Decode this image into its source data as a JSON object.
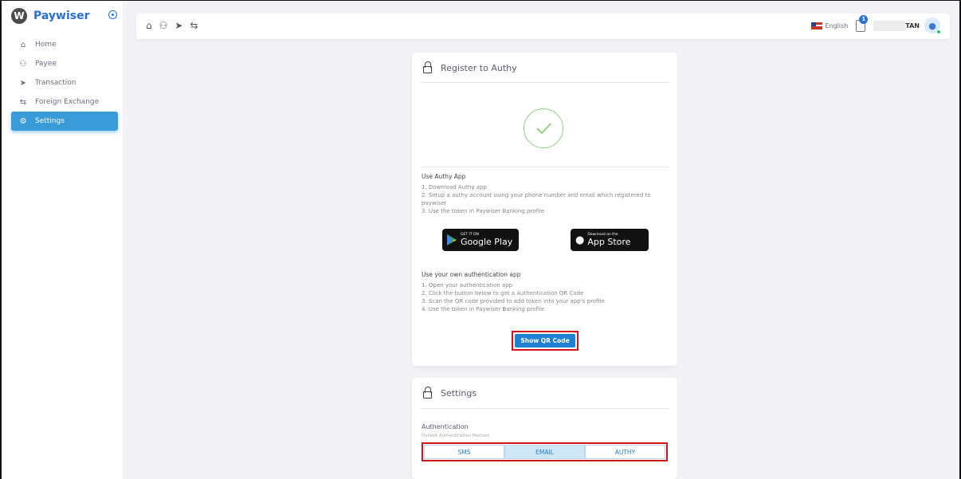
{
  "brand": {
    "name": "Paywiser",
    "logo_letter": "W"
  },
  "sidebar": {
    "items": [
      {
        "label": "Home",
        "icon": "home-icon",
        "glyph": "⌂",
        "active": false
      },
      {
        "label": "Payee",
        "icon": "users-icon",
        "glyph": "⚇",
        "active": false
      },
      {
        "label": "Transaction",
        "icon": "send-icon",
        "glyph": "➤",
        "active": false
      },
      {
        "label": "Foreign Exchange",
        "icon": "exchange-icon",
        "glyph": "⇆",
        "active": false
      },
      {
        "label": "Settings",
        "icon": "gear-icon",
        "glyph": "⚙",
        "active": true
      }
    ]
  },
  "topbar": {
    "language": "English",
    "notification_count": "1",
    "username": "TAN"
  },
  "authy_card": {
    "title": "Register to Authy",
    "authy_section_title": "Use Authy App",
    "authy_steps": [
      "1. Download Authy app",
      "2. Setup a authy account using your phone number and email which registered to paywiser",
      "3. Use the token in Paywiser Banking profile"
    ],
    "google_play": {
      "small": "GET IT ON",
      "large": "Google Play"
    },
    "app_store": {
      "small": "Download on the",
      "large": "App Store"
    },
    "own_app_title": "Use your own authentication app",
    "own_app_steps": [
      "1. Open your authentication app",
      "2. Click the button below to get a Authentication QR Code",
      "3. Scan the QR code provided to add token into your app's profile",
      "4. Use the token in Paywiser Banking profile"
    ],
    "qr_button": "Show QR Code"
  },
  "settings_card": {
    "title": "Settings",
    "auth_label": "Authentication",
    "auth_sub": "Default Authentication Method",
    "options": [
      "SMS",
      "EMAIL",
      "AUTHY"
    ],
    "selected": "EMAIL"
  },
  "colors": {
    "brand": "#2b6fd6",
    "active_nav": "#3a9bd9",
    "button": "#1f7fd0",
    "highlight": "#d0121b",
    "success": "#8fce83"
  }
}
